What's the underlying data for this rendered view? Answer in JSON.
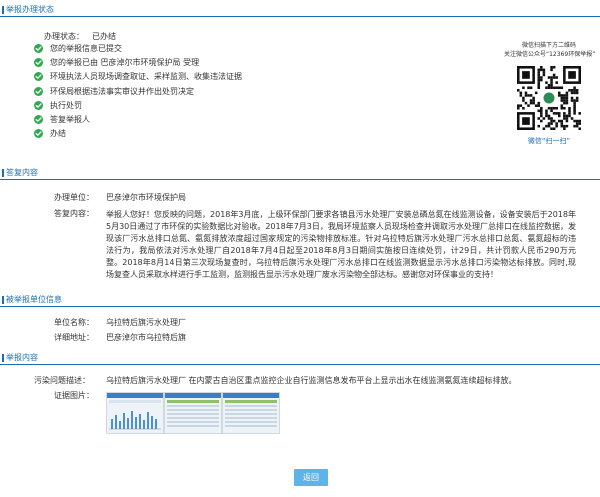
{
  "sections": {
    "status": "举报办理状态",
    "reply": "答复内容",
    "reported": "被举报单位信息",
    "report": "举报内容"
  },
  "status": {
    "label": "办理状态：",
    "value": "已办结",
    "steps": [
      "您的举报信息已提交",
      "您的举报已由 巴彦淖尔市环境保护局 受理",
      "环境执法人员现场调查取证、采样监测、收集违法证据",
      "环保局根据违法事实审议并作出处罚决定",
      "执行处罚",
      "答复举报人",
      "办结"
    ],
    "colors": {
      "check": "#2fa84f",
      "accent": "#1a6eb5"
    }
  },
  "qr": {
    "caption_line1": "微信扫描下方二维码",
    "caption_line2": "关注微信公众号“12369环保举报”",
    "footer": "微信“扫一扫”"
  },
  "reply": {
    "unit_label": "办理单位：",
    "unit_value": "巴彦淖尔市环境保护局",
    "content_label": "答复内容：",
    "content": "举报人您好！您反映的问题，2018年3月底，上级环保部门要求各镇县污水处理厂安装总磷总氮在线监测设备，设备安装后于2018年5月30日通过了市环保的实验数据比对验收。2018年7月3日，我局环境监察人员现场检查并调取污水处理厂总排口在线监控数据，发现该厂污水总排口总氮、氨氮排放浓度超过国家规定的污染物排放标准。针对乌拉特后旗污水处理厂污水总排口总氮、氨氮超标的违法行为，我局依法对污水处理厂自2018年7月4日起至2018年8月3日期间实施按日连续处罚，计29日，共计罚款人民币290万元整。2018年8月14日第三次现场复查时，乌拉特后旗污水处理厂污水总排口在线监测数据显示污水总排口污染物达标排放。同时,现场复查人员采取水样进行手工监测，监测报告显示污水处理厂废水污染物全部达标。感谢您对环保事业的支持！"
  },
  "reported": {
    "name_label": "单位名称：",
    "name_value": "乌拉特后旗污水处理厂",
    "addr_label": "详细地址：",
    "addr_value": "巴彦淖尔市乌拉特后旗"
  },
  "report": {
    "desc_label": "污染问题描述：",
    "desc_value": "乌拉特后旗污水处理厂 在内蒙古自治区重点监控企业自行监测信息发布平台上显示出水在线监测氨氮连续超标排放。",
    "images_label": "证据图片："
  },
  "back_button": "返回"
}
